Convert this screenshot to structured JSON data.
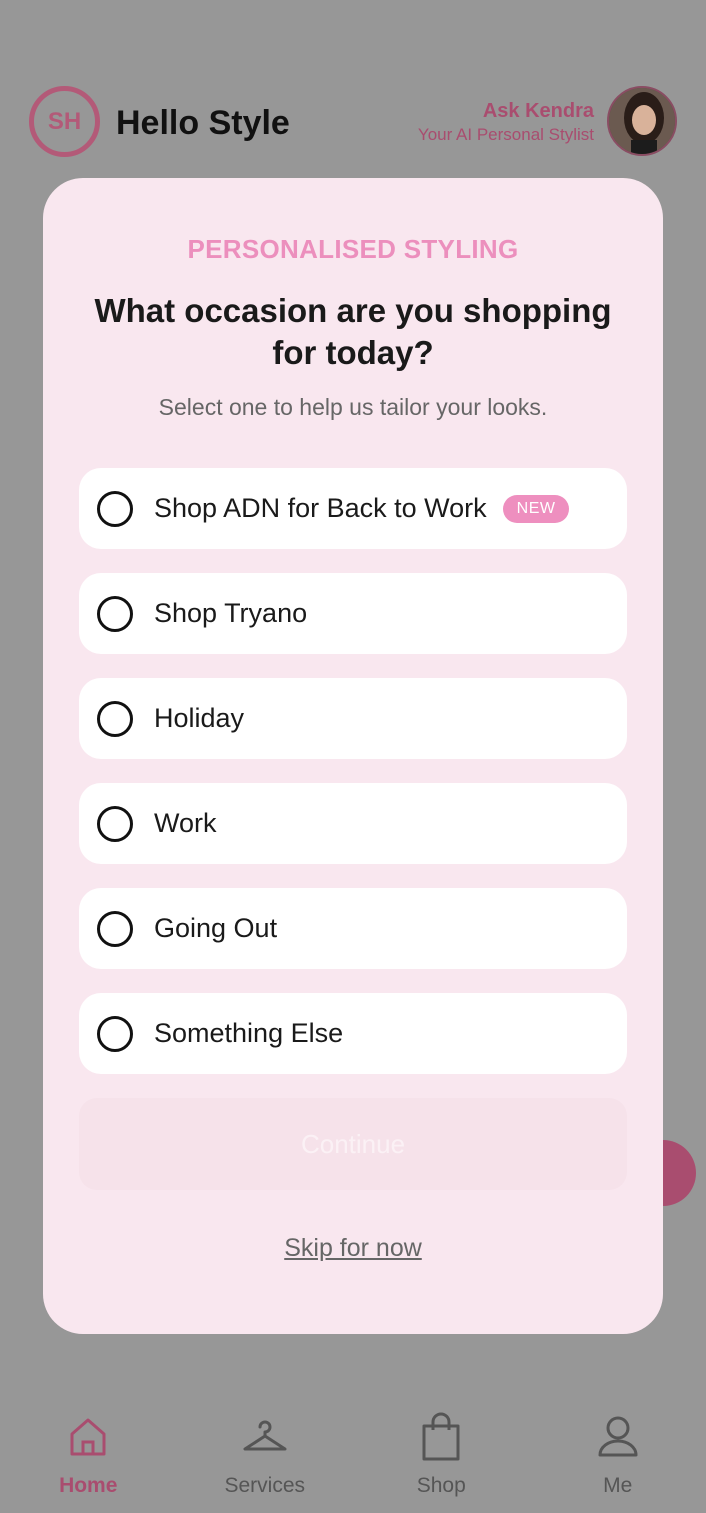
{
  "header": {
    "logo_initials": "SH",
    "app_title": "Hello Style",
    "stylist_name": "Ask Kendra",
    "stylist_subtitle": "Your AI Personal Stylist"
  },
  "modal": {
    "eyebrow": "PERSONALISED STYLING",
    "question": "What occasion are you shopping for today?",
    "helper": "Select one to help us tailor your looks.",
    "options": [
      {
        "label": "Shop ADN for Back to Work",
        "badge": "NEW"
      },
      {
        "label": "Shop Tryano"
      },
      {
        "label": "Holiday"
      },
      {
        "label": "Work"
      },
      {
        "label": "Going Out"
      },
      {
        "label": "Something Else"
      }
    ],
    "continue_label": "Continue",
    "skip_label": "Skip for now"
  },
  "nav": {
    "items": [
      {
        "label": "Home",
        "icon": "home-icon",
        "active": true
      },
      {
        "label": "Services",
        "icon": "hanger-icon"
      },
      {
        "label": "Shop",
        "icon": "shopping-bag-icon"
      },
      {
        "label": "Me",
        "icon": "person-icon"
      }
    ]
  },
  "colors": {
    "accent": "#ec8fbd",
    "brand": "#a94d6f",
    "modal_bg": "#f9e7ef",
    "overlay": "#979797"
  }
}
